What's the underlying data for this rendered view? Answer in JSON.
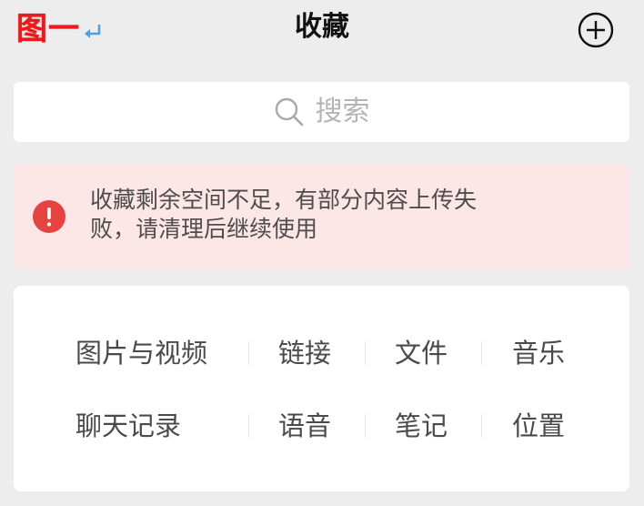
{
  "annotation": {
    "label": "图一",
    "color": "#f2161b",
    "arrow_color": "#4aa3e8",
    "arrow_icon": "return-arrow-icon"
  },
  "nav": {
    "title": "收藏",
    "add_icon": "plus-circle-icon"
  },
  "search": {
    "placeholder": "搜索",
    "icon": "search-icon"
  },
  "alert": {
    "message": "收藏剩余空间不足，有部分内容上传失败，请清理后继续使用",
    "icon": "exclamation-circle-icon",
    "icon_color": "#e64340",
    "background": "#fde6e6"
  },
  "categories": {
    "row1": [
      "图片与视频",
      "链接",
      "文件",
      "音乐"
    ],
    "row2": [
      "聊天记录",
      "语音",
      "笔记",
      "位置"
    ]
  },
  "colors": {
    "page_background": "#ededed",
    "card_background": "#ffffff",
    "text_primary": "#111111",
    "text_secondary": "#4a4a4a",
    "placeholder": "#b4b4b4"
  }
}
